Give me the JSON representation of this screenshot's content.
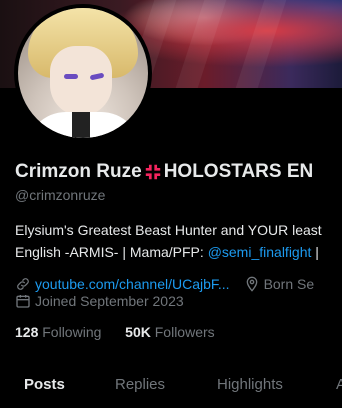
{
  "profile": {
    "name": "Crimzon Ruze",
    "name_suffix": "HOLOSTARS EN",
    "handle": "@crimzonruze",
    "bio_line1": "Elysium's Greatest Beast Hunter and YOUR least",
    "bio_line2_prefix": "English -ARMIS- | Mama/PFP: ",
    "bio_mention": "@semi_finalfight",
    "bio_line2_suffix": " |",
    "website": "youtube.com/channel/UCajbF...",
    "location": "Born Se",
    "joined": "Joined September 2023",
    "following_count": "128",
    "following_label": "Following",
    "followers_count": "50K",
    "followers_label": "Followers"
  },
  "tabs": [
    "Posts",
    "Replies",
    "Highlights",
    "A"
  ],
  "colors": {
    "accent": "#1d9bf0",
    "muted": "#71767b",
    "anger": "#f4245e"
  }
}
